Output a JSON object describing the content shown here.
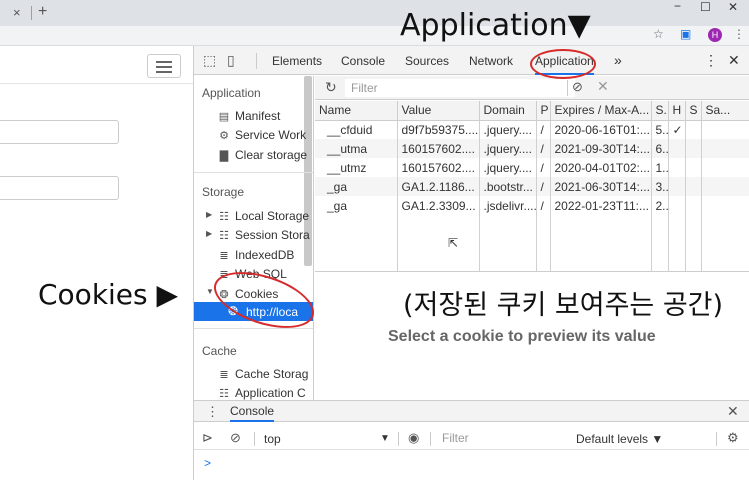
{
  "window": {
    "tab_close": "×",
    "new_tab": "+",
    "minimize": "−",
    "maximize": "☐",
    "close": "✕",
    "profile_initial": "H"
  },
  "devtools": {
    "tabs": [
      "Elements",
      "Console",
      "Sources",
      "Network",
      "Application"
    ],
    "more_tabs": "»",
    "menu": "⋮",
    "close": "✕",
    "sidebar": {
      "application_header": "Application",
      "application_items": [
        "Manifest",
        "Service Work",
        "Clear storage"
      ],
      "storage_header": "Storage",
      "storage_items": [
        "Local Storage",
        "Session Stora",
        "IndexedDB",
        "Web SQL",
        "Cookies"
      ],
      "selected_cookie_origin": "http://loca",
      "cache_header": "Cache",
      "cache_items": [
        "Cache Storag",
        "Application C"
      ]
    },
    "cookies": {
      "filter_placeholder": "Filter",
      "columns": [
        "Name",
        "Value",
        "Domain",
        "P",
        "Expires / Max-A...",
        "S.",
        "H",
        "S",
        "Sa..."
      ],
      "rows": [
        [
          "__cfduid",
          "d9f7b59375....",
          ".jquery....",
          "/",
          "2020-06-16T01:...",
          "5..",
          "✓",
          "",
          ""
        ],
        [
          "__utma",
          "160157602....",
          ".jquery....",
          "/",
          "2021-09-30T14:...",
          "6..",
          "",
          "",
          ""
        ],
        [
          "__utmz",
          "160157602....",
          ".jquery....",
          "/",
          "2020-04-01T02:...",
          "1..",
          "",
          "",
          ""
        ],
        [
          "_ga",
          "GA1.2.1186...",
          ".bootstr...",
          "/",
          "2021-06-30T14:...",
          "3..",
          "",
          "",
          ""
        ],
        [
          "_ga",
          "GA1.2.3309...",
          ".jsdelivr....",
          "/",
          "2022-01-23T11:...",
          "2..",
          "",
          "",
          ""
        ]
      ],
      "preview_message": "Select a cookie to preview its value"
    },
    "drawer": {
      "title": "Console",
      "context": "top",
      "filter_placeholder": "Filter",
      "levels": "Default levels ▼",
      "prompt": ">"
    }
  },
  "annotations": {
    "application": "Application▼",
    "cookies": "Cookies ▶",
    "korean": "(저장된 쿠키 보여주는 공간)"
  }
}
